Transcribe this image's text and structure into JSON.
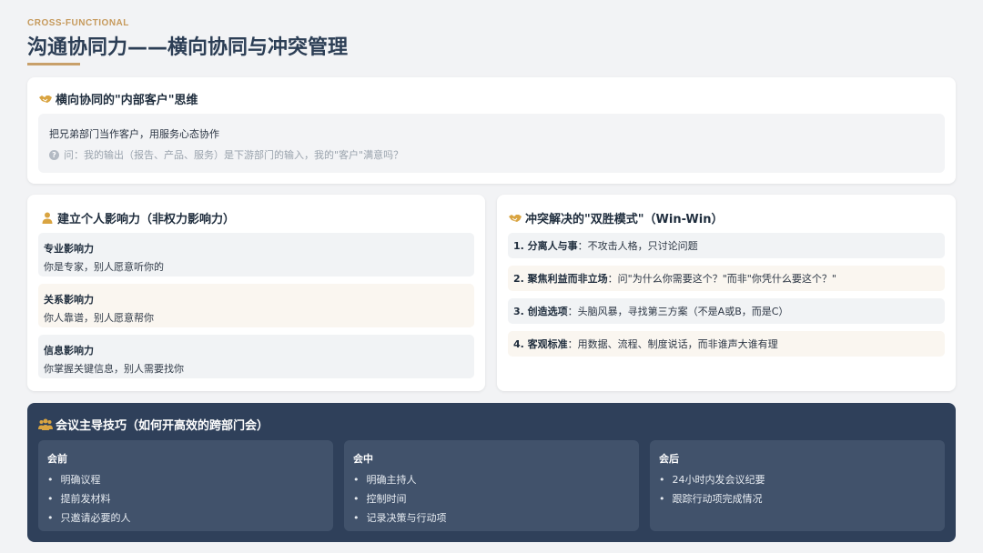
{
  "header": {
    "eyebrow": "CROSS-FUNCTIONAL",
    "title": "沟通协同力——横向协同与冲突管理"
  },
  "internal_customer": {
    "title": "横向协同的\"内部客户\"思维",
    "icon": "handshake-icon",
    "statement": "把兄弟部门当作客户，用服务心态协作",
    "question": "问：我的输出（报告、产品、服务）是下游部门的输入，我的\"客户\"满意吗？"
  },
  "influence": {
    "title": "建立个人影响力（非权力影响力）",
    "icon": "person-icon",
    "items": [
      {
        "heading": "专业影响力",
        "desc": "你是专家，别人愿意听你的"
      },
      {
        "heading": "关系影响力",
        "desc": "你人靠谱，别人愿意帮你"
      },
      {
        "heading": "信息影响力",
        "desc": "你掌握关键信息，别人需要找你"
      }
    ]
  },
  "win_win": {
    "title": "冲突解决的\"双胜模式\"（Win-Win）",
    "icon": "handshake-icon",
    "steps": [
      {
        "label": "1. 分离人与事",
        "text": "：不攻击人格，只讨论问题"
      },
      {
        "label": "2. 聚焦利益而非立场",
        "text": "：问\"为什么你需要这个？\"而非\"你凭什么要这个？\""
      },
      {
        "label": "3. 创造选项",
        "text": "：头脑风暴，寻找第三方案（不是A或B，而是C）"
      },
      {
        "label": "4. 客观标准",
        "text": "：用数据、流程、制度说话，而非谁声大谁有理"
      }
    ]
  },
  "meeting": {
    "title": "会议主导技巧（如何开高效的跨部门会）",
    "icon": "people-group-icon",
    "columns": [
      {
        "heading": "会前",
        "items": [
          "明确议程",
          "提前发材料",
          "只邀请必要的人"
        ]
      },
      {
        "heading": "会中",
        "items": [
          "明确主持人",
          "控制时间",
          "记录决策与行动项"
        ]
      },
      {
        "heading": "会后",
        "items": [
          "24小时内发会议纪要",
          "跟踪行动项完成情况"
        ]
      }
    ]
  },
  "colors": {
    "accent": "#c8a06a",
    "navy": "#2f405a",
    "navy_panel": "#41526b"
  }
}
